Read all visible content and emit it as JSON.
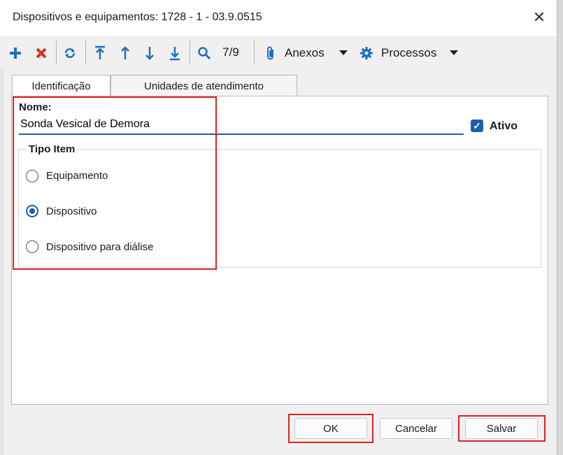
{
  "window": {
    "title": "Dispositivos e equipamentos: 1728 - 1 - 03.9.0515",
    "close_glyph": "✕"
  },
  "toolbar": {
    "add_icon": "plus-icon",
    "delete_icon": "x-icon",
    "refresh_icon": "refresh-icon",
    "first_icon": "arrow-top-icon",
    "prev_icon": "arrow-up-icon",
    "next_icon": "arrow-down-icon",
    "last_icon": "arrow-bottom-icon",
    "search_icon": "search-icon",
    "record_position": "7/9",
    "anexos_label": "Anexos",
    "processos_label": "Processos",
    "accent_blue": "#1f6fc0",
    "accent_red": "#d9301f"
  },
  "tabs": [
    {
      "label": "Identificação",
      "active": true
    },
    {
      "label": "Unidades de atendimento",
      "active": false
    }
  ],
  "form": {
    "nome_label": "Nome:",
    "nome_value": "Sonda Vesical de Demora",
    "ativo_label": "Ativo",
    "ativo_checked": true,
    "tipo_item_label": "Tipo Item",
    "tipo_options": [
      {
        "label": "Equipamento",
        "selected": false
      },
      {
        "label": "Dispositivo",
        "selected": true
      },
      {
        "label": "Dispositivo para diálise",
        "selected": false
      }
    ]
  },
  "buttons": {
    "ok": "OK",
    "cancelar": "Cancelar",
    "salvar": "Salvar"
  },
  "highlight_color": "#e02020"
}
